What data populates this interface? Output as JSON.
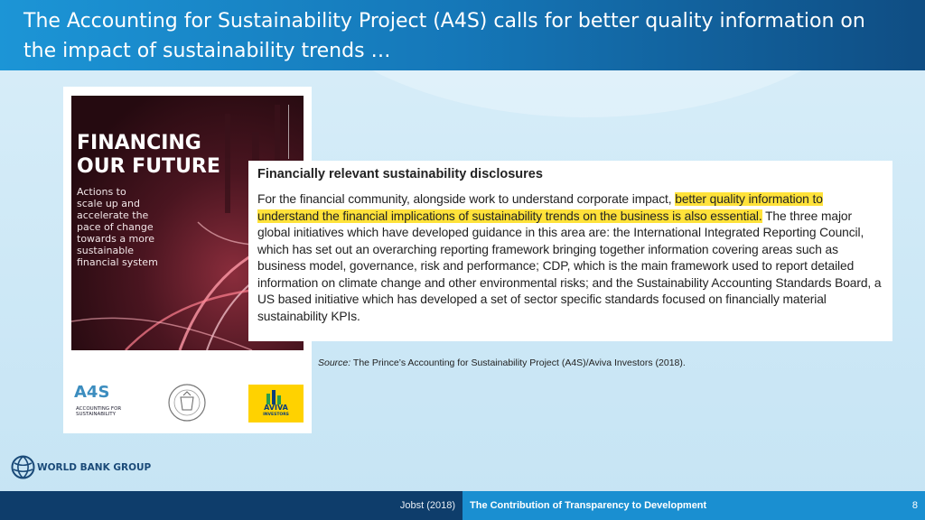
{
  "slide": {
    "title": "The Accounting for Sustainability Project (A4S) calls for better quality information on the impact of sustainability trends …"
  },
  "cover": {
    "title": "FINANCING\nOUR FUTURE",
    "subtitle": "Actions to\nscale up and\naccelerate the\npace of change\ntowards a more\nsustainable\nfinancial system"
  },
  "logos": {
    "a4s_mark": "A4S",
    "a4s_sub": "ACCOUNTING FOR\nSUSTAINABILITY",
    "aviva_name": "AVIVA",
    "aviva_sub": "INVESTORS"
  },
  "excerpt": {
    "heading": "Financially relevant sustainability disclosures",
    "text_before": "For the financial community, alongside work to understand corporate impact, ",
    "highlight": "better quality information to understand the financial implications of sustainability trends on the business is also essential.",
    "text_after": " The three major global initiatives which have developed guidance in this area are: the International Integrated Reporting Council, which has set out an overarching reporting framework bringing together information covering areas such as business model, governance, risk and performance; CDP, which is the main framework used to report detailed information on climate change and other environmental risks; and the Sustainability Accounting Standards Board, a US based initiative which has developed a set of sector specific standards focused on financially material sustainability KPIs."
  },
  "source": {
    "label": "Source:",
    "text": " The Prince’s Accounting for Sustainability Project (A4S)/Aviva Investors (2018)."
  },
  "brand": {
    "name": "WORLD BANK GROUP"
  },
  "footer": {
    "author": "Jobst (2018)",
    "deck_title": "The Contribution of Transparency to Development",
    "page_number": "8"
  },
  "colors": {
    "title_bar": "#1577b8",
    "footer_dark": "#0e3d6b",
    "footer_accent": "#1a8fd1",
    "highlight": "#ffe23a",
    "aviva_yellow": "#ffd200"
  }
}
